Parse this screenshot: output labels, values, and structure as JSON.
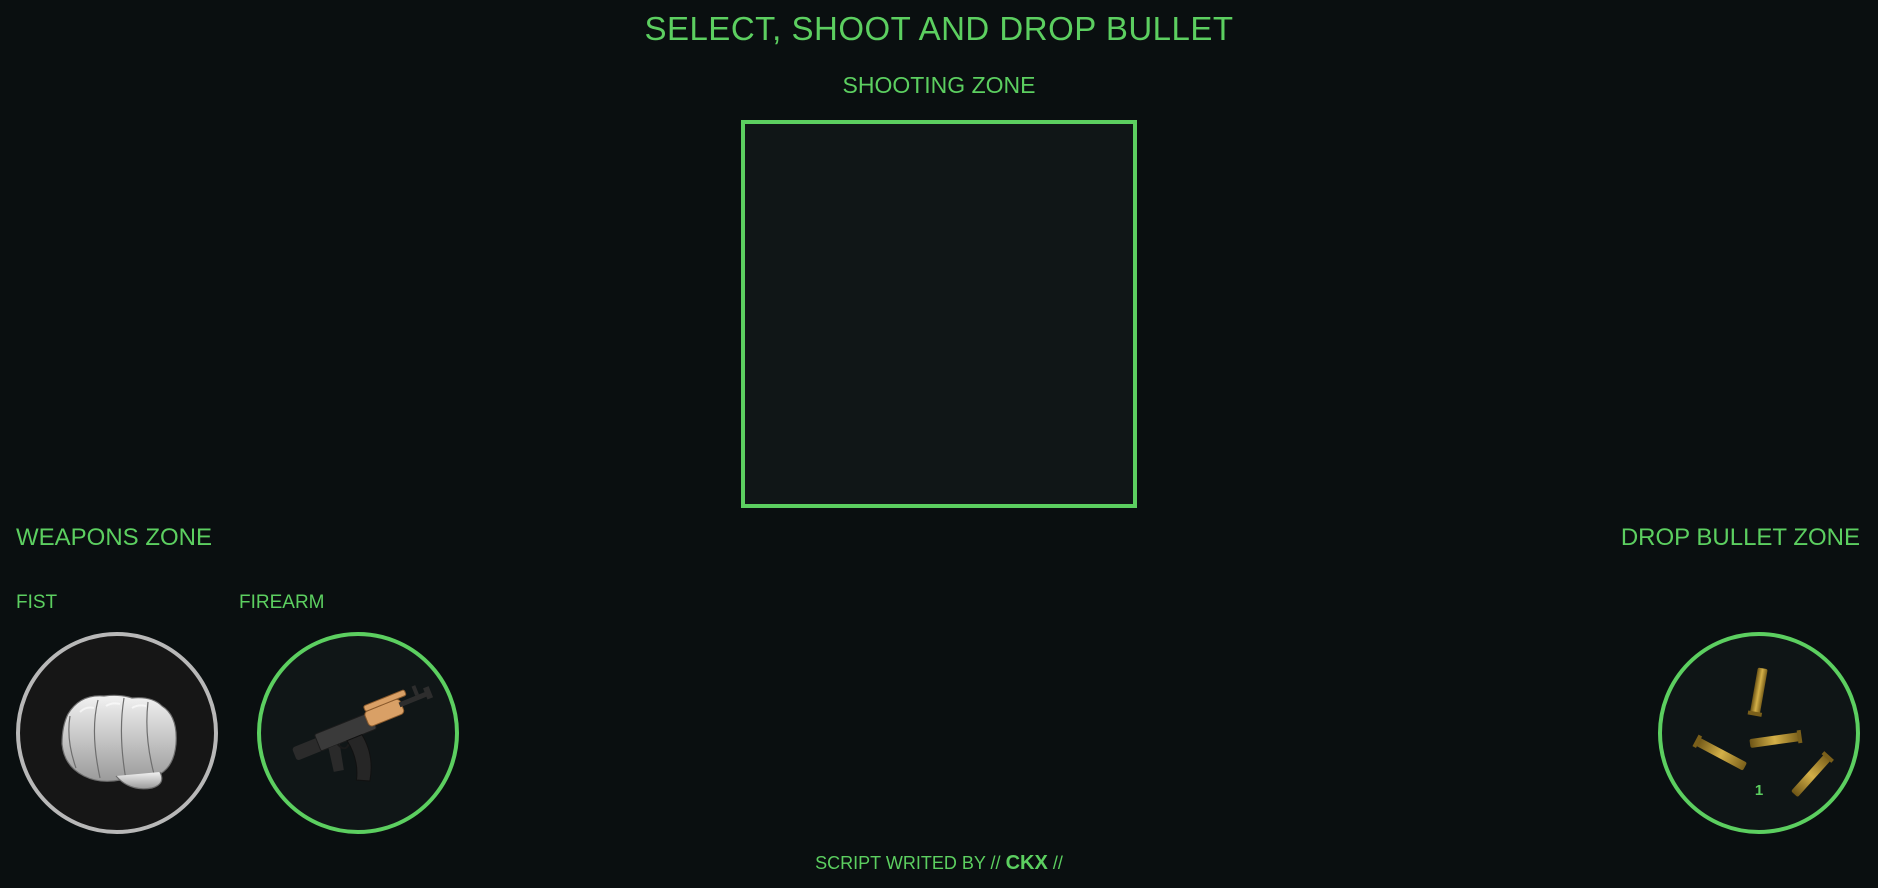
{
  "header": {
    "title": "SELECT, SHOOT AND DROP BULLET",
    "subtitle": "SHOOTING ZONE"
  },
  "weapons_zone": {
    "label": "WEAPONS ZONE",
    "items": [
      {
        "label": "FIST",
        "icon": "fist-icon",
        "selected": false
      },
      {
        "label": "FIREARM",
        "icon": "rifle-icon",
        "selected": true
      }
    ]
  },
  "drop_zone": {
    "label": "DROP BULLET ZONE",
    "icon": "bullet-casings-icon",
    "count": "1"
  },
  "footer": {
    "prefix": "SCRIPT WRITED BY //",
    "author": "CKX",
    "suffix": "//"
  },
  "colors": {
    "accent": "#5ccf60",
    "background": "#0a0f10",
    "zone_fill": "#101617",
    "inactive_ring": "#b8b8b8"
  }
}
